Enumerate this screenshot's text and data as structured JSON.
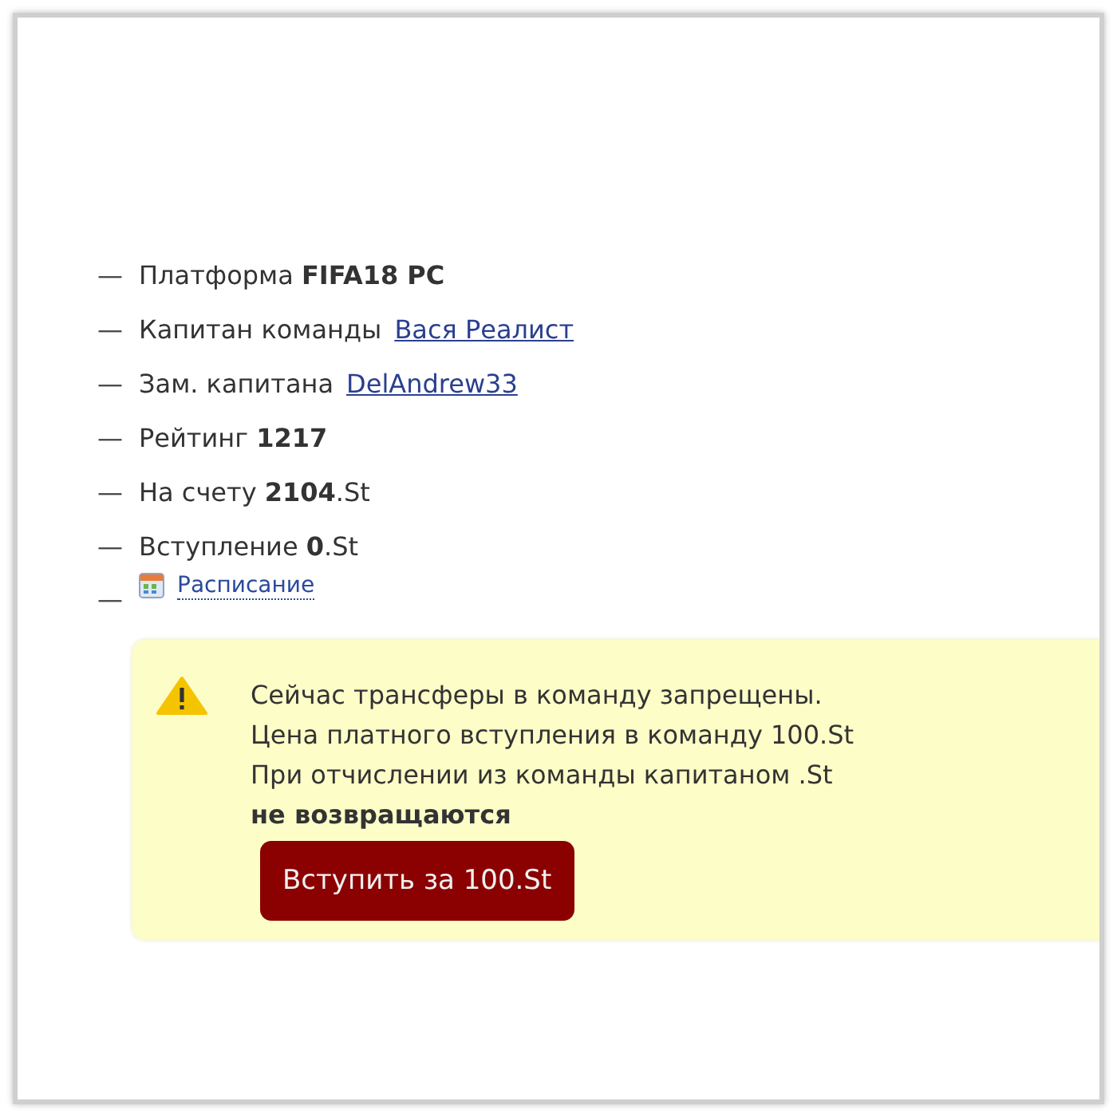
{
  "info_list": [
    {
      "kind": "text",
      "bullet": "—",
      "text": "Платформа **FIFA18 PC**"
    },
    {
      "kind": "link",
      "bullet": "—",
      "label": "Капитан команды",
      "link": "Вася Реалист"
    },
    {
      "kind": "link",
      "bullet": "—",
      "label": "Зам. капитана",
      "link": "DelAndrew33"
    },
    {
      "kind": "text",
      "bullet": "—",
      "text": "Рейтинг **1217**"
    },
    {
      "kind": "text",
      "bullet": "—",
      "text": "На счету **2104**.St"
    },
    {
      "kind": "text",
      "bullet": "—",
      "text": "Вступление **0**.St"
    },
    {
      "kind": "schedule",
      "bullet": "—",
      "link": "Расписание"
    }
  ],
  "notice": {
    "lines": [
      {
        "text": "Сейчас трансферы в команду запрещены.",
        "bold": false
      },
      {
        "text": "Цена платного вступления в команду 100.St",
        "bold": false
      },
      {
        "text": "При отчислении из команды капитаном .St",
        "bold": false
      },
      {
        "text": "не возвращаются",
        "bold": true
      }
    ],
    "button": "Вступить за 100.St"
  }
}
